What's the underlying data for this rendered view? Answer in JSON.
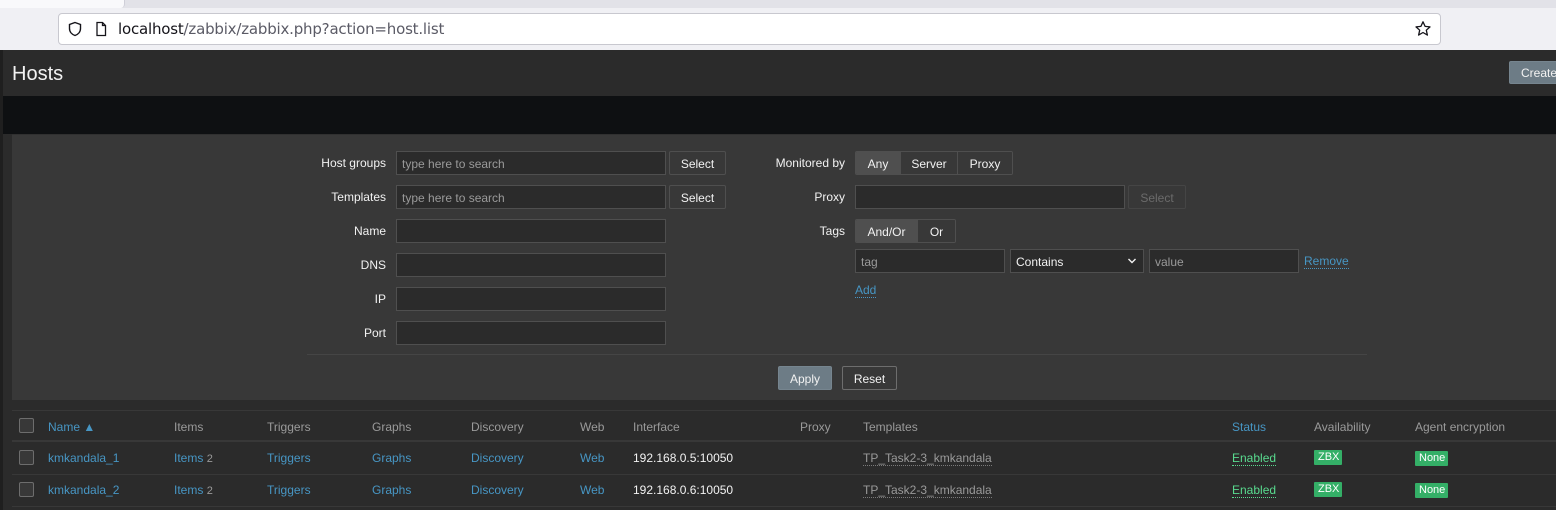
{
  "browser": {
    "url_host": "localhost",
    "url_path": "/zabbix/zabbix.php?action=host.list"
  },
  "page": {
    "title": "Hosts",
    "create_label": "Create"
  },
  "filter": {
    "host_groups_label": "Host groups",
    "host_groups_placeholder": "type here to search",
    "templates_label": "Templates",
    "templates_placeholder": "type here to search",
    "select_label": "Select",
    "name_label": "Name",
    "dns_label": "DNS",
    "ip_label": "IP",
    "port_label": "Port",
    "monitored_by_label": "Monitored by",
    "monitored_by_options": [
      "Any",
      "Server",
      "Proxy"
    ],
    "monitored_by_selected": "Any",
    "proxy_label": "Proxy",
    "tags_label": "Tags",
    "tags_options": [
      "And/Or",
      "Or"
    ],
    "tags_selected": "And/Or",
    "tag_placeholder": "tag",
    "tag_operator": "Contains",
    "value_placeholder": "value",
    "remove_label": "Remove",
    "add_label": "Add",
    "apply_label": "Apply",
    "reset_label": "Reset"
  },
  "table": {
    "columns": [
      "Name ▲",
      "Items",
      "Triggers",
      "Graphs",
      "Discovery",
      "Web",
      "Interface",
      "Proxy",
      "Templates",
      "Status",
      "Availability",
      "Agent encryption"
    ],
    "rows": [
      {
        "name": "kmkandala_1",
        "items": "Items",
        "items_count": "2",
        "triggers": "Triggers",
        "graphs": "Graphs",
        "discovery": "Discovery",
        "web": "Web",
        "interface": "192.168.0.5:10050",
        "proxy": "",
        "templates": "TP_Task2-3_kmkandala",
        "status": "Enabled",
        "availability": "ZBX",
        "encryption": "None"
      },
      {
        "name": "kmkandala_2",
        "items": "Items",
        "items_count": "2",
        "triggers": "Triggers",
        "graphs": "Graphs",
        "discovery": "Discovery",
        "web": "Web",
        "interface": "192.168.0.6:10050",
        "proxy": "",
        "templates": "TP_Task2-3_kmkandala",
        "status": "Enabled",
        "availability": "ZBX",
        "encryption": "None"
      }
    ]
  },
  "colors": {
    "link": "#4796c4",
    "enabled": "#59db8f",
    "badge_green": "#34af67",
    "background": "#2b2b2b",
    "panel": "#383838"
  }
}
